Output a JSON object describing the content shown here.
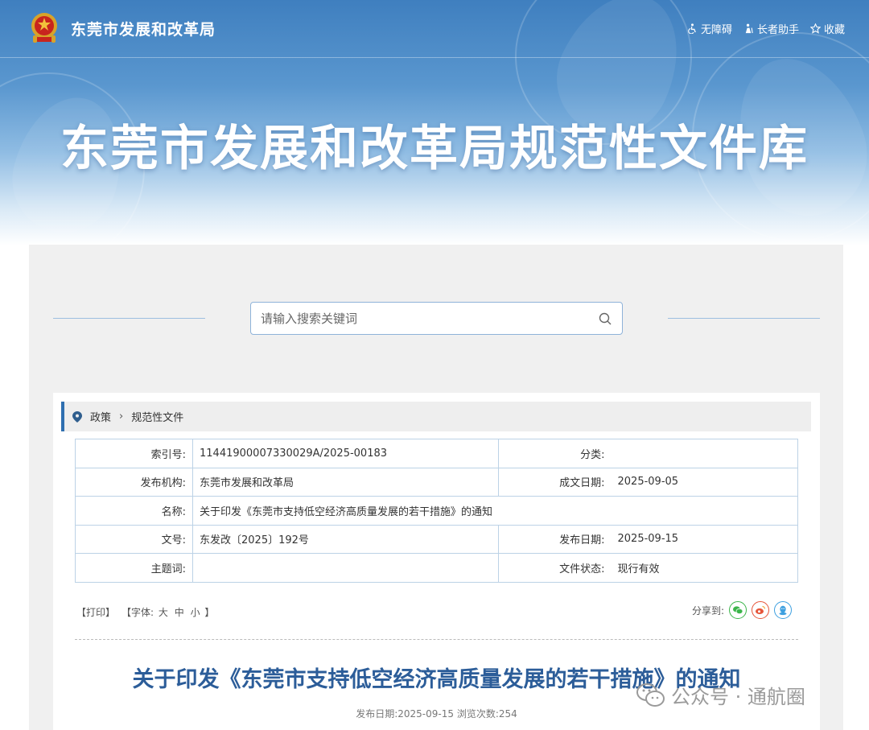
{
  "header": {
    "site_name": "东莞市发展和改革局",
    "banner_title": "东莞市发展和改革局规范性文件库",
    "tools": [
      {
        "label": "无障碍",
        "icon": "accessibility-icon"
      },
      {
        "label": "长者助手",
        "icon": "elder-helper-icon"
      },
      {
        "label": "收藏",
        "icon": "star-icon"
      }
    ]
  },
  "search": {
    "placeholder": "请输入搜索关键词"
  },
  "breadcrumb": {
    "items": [
      "政策",
      "规范性文件"
    ]
  },
  "info": {
    "index_label": "索引号:",
    "index_value": "11441900007330029A/2025-00183",
    "category_label": "分类:",
    "category_value": "",
    "agency_label": "发布机构:",
    "agency_value": "东莞市发展和改革局",
    "written_date_label": "成文日期:",
    "written_date_value": "2025-09-05",
    "name_label": "名称:",
    "name_value": "关于印发《东莞市支持低空经济高质量发展的若干措施》的通知",
    "doc_no_label": "文号:",
    "doc_no_value": "东发改〔2025〕192号",
    "publish_date_label": "发布日期:",
    "publish_date_value": "2025-09-15",
    "subject_label": "主题词:",
    "subject_value": "",
    "status_label": "文件状态:",
    "status_value": "现行有效"
  },
  "doc_tools": {
    "print": "【打印】",
    "font_prefix": "【字体:",
    "font_large": "大",
    "font_medium": "中",
    "font_small": "小",
    "font_suffix": "】",
    "share_label": "分享到:"
  },
  "article": {
    "title": "关于印发《东莞市支持低空经济高质量发展的若干措施》的通知",
    "meta": "发布日期:2025-09-15  浏览次数:254"
  },
  "watermark": {
    "text": "公众号 · 通航圈"
  },
  "colors": {
    "accent": "#2f6fb0",
    "title": "#2c5d99",
    "wechat": "#3bb54a",
    "weibo": "#e6553a",
    "qq": "#3ea0e0"
  }
}
